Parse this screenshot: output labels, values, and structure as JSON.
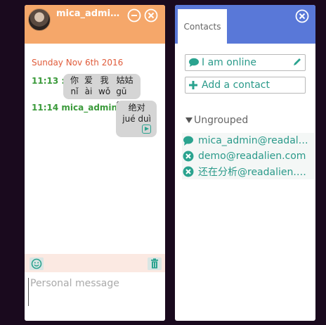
{
  "chat": {
    "name": "mica_admin@readalien.com",
    "date": "Sunday Nov 6th 2016",
    "messages": [
      {
        "time": "11:13 :",
        "sender": "",
        "chars": [
          {
            "hz": "你",
            "py": "nǐ"
          },
          {
            "hz": "爱",
            "py": "ài"
          },
          {
            "hz": "我",
            "py": "wǒ"
          },
          {
            "hz": "姑姑",
            "py": "gū gu"
          }
        ]
      },
      {
        "time": "11:14",
        "sender": "mica_admin:",
        "chars": [
          {
            "hz": "绝对",
            "py": "jué duì"
          }
        ]
      }
    ],
    "input_placeholder": "Personal message"
  },
  "contacts": {
    "tab_label": "Contacts",
    "status_label": "I am online",
    "add_contact_label": "Add a contact",
    "group_name": "Ungrouped",
    "items": [
      {
        "name": "mica_admin@readalien.com",
        "status": "online"
      },
      {
        "name": "demo@readalien.com",
        "status": "offline"
      },
      {
        "name": "还在分析@readalien.com",
        "status": "offline"
      }
    ]
  },
  "colors": {
    "chat_header": "#f5a76a",
    "contacts_header": "#5978d8",
    "accent_teal": "#2a9a8a",
    "date_red": "#e05b3a",
    "time_green": "#3a9a3a"
  },
  "icons": {
    "minimize": "minimize-icon",
    "close": "close-icon",
    "smiley": "smiley-icon",
    "trash": "trash-icon",
    "chat_bubble": "chat-bubble-icon",
    "pencil": "pencil-icon",
    "plus": "plus-icon",
    "offline": "offline-x-icon"
  }
}
